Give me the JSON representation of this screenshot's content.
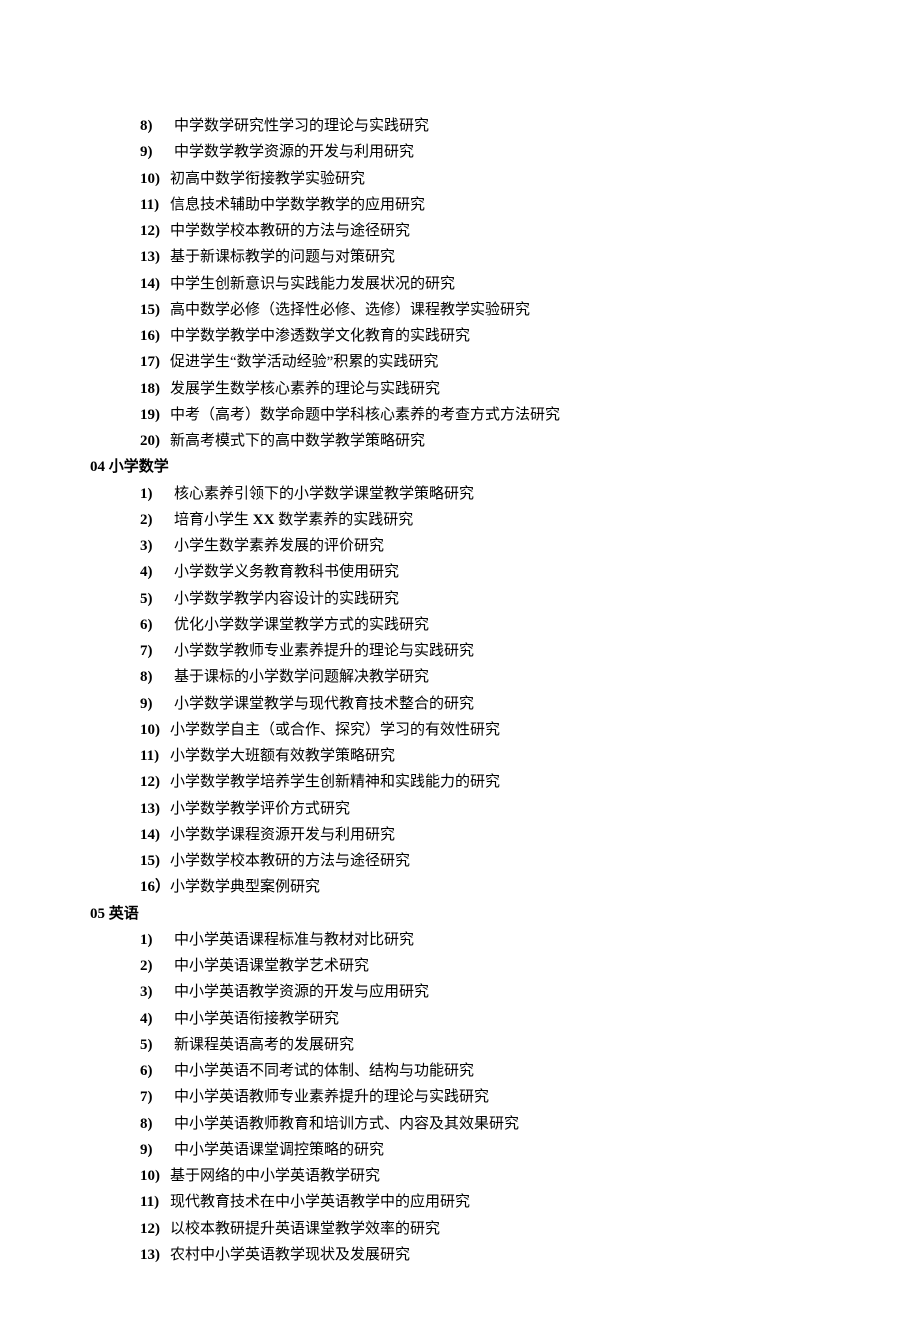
{
  "top_items": [
    {
      "num": "8)",
      "text": "中学数学研究性学习的理论与实践研究"
    },
    {
      "num": "9)",
      "text": "中学数学教学资源的开发与利用研究"
    },
    {
      "num": "10)",
      "text": "初高中数学衔接教学实验研究"
    },
    {
      "num": "11)",
      "text": "信息技术辅助中学数学教学的应用研究"
    },
    {
      "num": "12)",
      "text": "中学数学校本教研的方法与途径研究"
    },
    {
      "num": "13)",
      "text": "基于新课标教学的问题与对策研究"
    },
    {
      "num": "14)",
      "text": "中学生创新意识与实践能力发展状况的研究"
    },
    {
      "num": "15)",
      "text": "高中数学必修（选择性必修、选修）课程教学实验研究"
    },
    {
      "num": "16)",
      "text": "中学数学教学中渗透数学文化教育的实践研究"
    },
    {
      "num": "17)",
      "text": "促进学生“数学活动经验”积累的实践研究"
    },
    {
      "num": "18)",
      "text": "发展学生数学核心素养的理论与实践研究"
    },
    {
      "num": "19)",
      "text": "中考（高考）数学命题中学科核心素养的考查方式方法研究"
    },
    {
      "num": "20)",
      "text": "新高考模式下的高中数学教学策略研究"
    }
  ],
  "section04": {
    "heading": "04 小学数学",
    "items": [
      {
        "num": "1)",
        "text": "核心素养引领下的小学数学课堂教学策略研究"
      },
      {
        "num": "2)",
        "text_pre": "培育小学生 ",
        "text_mid": "XX",
        "text_post": " 数学素养的实践研究"
      },
      {
        "num": "3)",
        "text": "小学生数学素养发展的评价研究"
      },
      {
        "num": "4)",
        "text": "小学数学义务教育教科书使用研究"
      },
      {
        "num": "5)",
        "text": "小学数学教学内容设计的实践研究"
      },
      {
        "num": "6)",
        "text": "优化小学数学课堂教学方式的实践研究"
      },
      {
        "num": "7)",
        "text": "小学数学教师专业素养提升的理论与实践研究"
      },
      {
        "num": "8)",
        "text": "基于课标的小学数学问题解决教学研究"
      },
      {
        "num": "9)",
        "text": "小学数学课堂教学与现代教育技术整合的研究"
      },
      {
        "num": "10)",
        "text": "小学数学自主（或合作、探究）学习的有效性研究"
      },
      {
        "num": "11)",
        "text": "小学数学大班额有效教学策略研究"
      },
      {
        "num": "12)",
        "text": "小学数学教学培养学生创新精神和实践能力的研究"
      },
      {
        "num": "13)",
        "text": "小学数学教学评价方式研究"
      },
      {
        "num": "14)",
        "text": "小学数学课程资源开发与利用研究"
      },
      {
        "num": "15)",
        "text": "小学数学校本教研的方法与途径研究"
      },
      {
        "num": "16）",
        "text": "小学数学典型案例研究"
      }
    ]
  },
  "section05": {
    "heading": "05 英语",
    "items": [
      {
        "num": "1)",
        "text": "中小学英语课程标准与教材对比研究"
      },
      {
        "num": "2)",
        "text": "中小学英语课堂教学艺术研究"
      },
      {
        "num": "3)",
        "text": "中小学英语教学资源的开发与应用研究"
      },
      {
        "num": "4)",
        "text": "中小学英语衔接教学研究"
      },
      {
        "num": "5)",
        "text": "新课程英语高考的发展研究"
      },
      {
        "num": "6)",
        "text": "中小学英语不同考试的体制、结构与功能研究"
      },
      {
        "num": "7)",
        "text": "中小学英语教师专业素养提升的理论与实践研究"
      },
      {
        "num": "8)",
        "text": "中小学英语教师教育和培训方式、内容及其效果研究"
      },
      {
        "num": "9)",
        "text": "中小学英语课堂调控策略的研究"
      },
      {
        "num": "10)",
        "text": "基于网络的中小学英语教学研究"
      },
      {
        "num": "11)",
        "text": "现代教育技术在中小学英语教学中的应用研究"
      },
      {
        "num": "12)",
        "text": "以校本教研提升英语课堂教学效率的研究"
      },
      {
        "num": "13)",
        "text": "农村中小学英语教学现状及发展研究"
      }
    ]
  }
}
